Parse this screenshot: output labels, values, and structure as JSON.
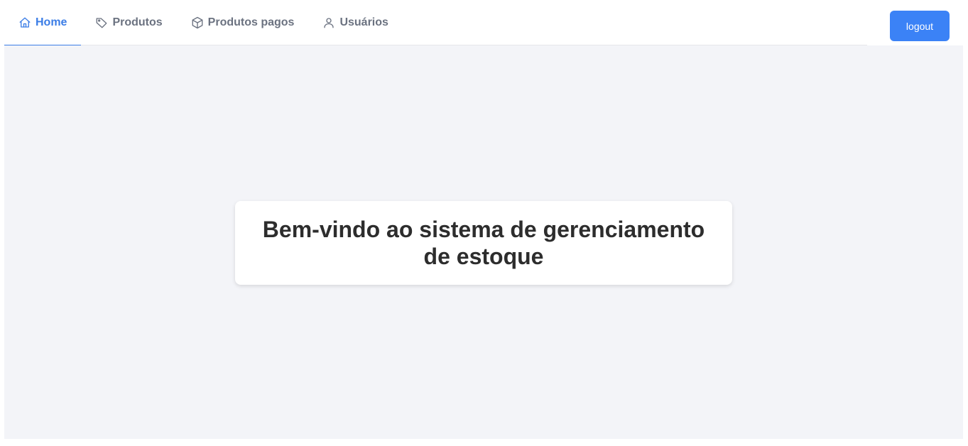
{
  "nav": {
    "items": [
      {
        "label": "Home",
        "icon": "home-icon",
        "active": true
      },
      {
        "label": "Produtos",
        "icon": "tag-icon",
        "active": false
      },
      {
        "label": "Produtos pagos",
        "icon": "box-icon",
        "active": false
      },
      {
        "label": "Usuários",
        "icon": "user-icon",
        "active": false
      }
    ]
  },
  "header": {
    "logout_label": "logout"
  },
  "main": {
    "welcome_text": "Bem-vindo ao sistema de gerenciamento de estoque"
  },
  "colors": {
    "accent": "#3b7de6",
    "button": "#3b82f6",
    "content_bg": "#f3f4f8",
    "nav_text": "#6b7280"
  }
}
